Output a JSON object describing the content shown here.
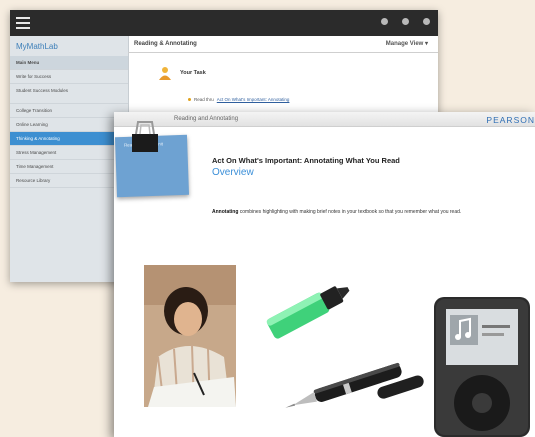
{
  "back_window": {
    "brand": "MyMathLab",
    "side_items": [
      {
        "label": "Main Menu",
        "variant": "main"
      },
      {
        "label": "Write for Success",
        "variant": ""
      },
      {
        "label": "Student Success Modules",
        "variant": "tall"
      },
      {
        "label": "College Transition",
        "variant": ""
      },
      {
        "label": "Online Learning",
        "variant": ""
      },
      {
        "label": "Thinking & Annotating",
        "variant": "active"
      },
      {
        "label": "Stress Management",
        "variant": ""
      },
      {
        "label": "Time Management",
        "variant": ""
      },
      {
        "label": "Resource Library",
        "variant": ""
      }
    ],
    "content_title": "Reading & Annotating",
    "manage_view": "Manage View ▾",
    "task_title": "Your Task",
    "task_link_prefix": "Read thru",
    "task_link": "Act On What's Important: Annotating"
  },
  "slide": {
    "tab_label": "Reading and Annotating",
    "brand": "PEARSON",
    "sticky_text": "Reading Skills: Unit",
    "title": "Act On What's Important: Annotating What You Read",
    "subtitle": "Overview",
    "intro_bold": "Annotating",
    "intro_rest": "combines highlighting with making brief notes in your textbook so that you remember what you read."
  },
  "colors": {
    "accent": "#3d8fd1",
    "top_bar": "#2b2b2b",
    "background": "#f6ede0",
    "pearson_blue": "#2f6fb5"
  }
}
